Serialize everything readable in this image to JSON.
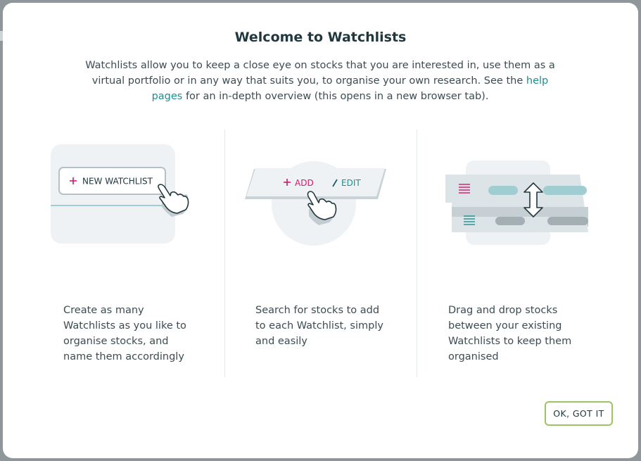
{
  "modal": {
    "title": "Welcome to Watchlists",
    "intro_text": "Watchlists allow you to keep a close eye on stocks that you are interested in, use them as a virtual portfolio or in any way that suits you, to organise your own research. See the ",
    "help_link": "help pages",
    "intro_text_end": " for an in-depth overview (this opens in a new browser tab).",
    "ok_button": "OK, GOT IT"
  },
  "columns": [
    {
      "illustration": {
        "button_label": "NEW WATCHLIST",
        "icons": [
          "plus-icon",
          "pointer-hand-icon"
        ]
      },
      "text": "Create as many Watchlists as you like to organise stocks, and name them accordingly"
    },
    {
      "illustration": {
        "add_label": "ADD",
        "edit_label": "EDIT",
        "icons": [
          "plus-icon",
          "pencil-icon",
          "pointer-hand-icon"
        ]
      },
      "text": "Search for stocks to add to each Watchlist, simply and easily"
    },
    {
      "illustration": {
        "icons": [
          "list-icon",
          "drag-arrow-icon"
        ]
      },
      "text": "Drag and drop stocks between your existing Watchlists to keep them organised"
    }
  ],
  "colors": {
    "accent_teal": "#1d8e8e",
    "accent_pink": "#d6176b",
    "button_border": "#9bc55e",
    "title": "#21383f"
  }
}
